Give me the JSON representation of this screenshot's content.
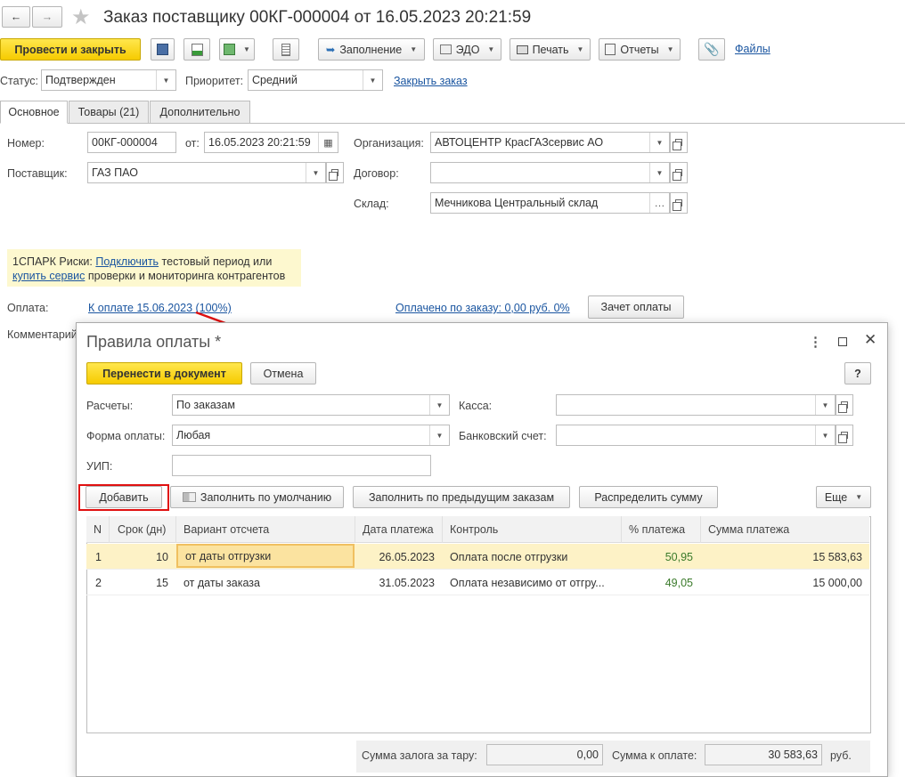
{
  "window": {
    "title": "Заказ поставщику 00КГ-000004 от 16.05.2023 20:21:59"
  },
  "toolbar": {
    "post_close": "Провести и закрыть",
    "fill": "Заполнение",
    "edo": "ЭДО",
    "print": "Печать",
    "reports": "Отчеты",
    "files": "Файлы"
  },
  "status": {
    "label": "Статус:",
    "value": "Подтвержден",
    "priority_label": "Приоритет:",
    "priority_value": "Средний",
    "close_link": "Закрыть заказ"
  },
  "tabs": [
    {
      "label": "Основное"
    },
    {
      "label": "Товары (21)"
    },
    {
      "label": "Дополнительно"
    }
  ],
  "main": {
    "number_label": "Номер:",
    "number": "00КГ-000004",
    "from_label": "от:",
    "date": "16.05.2023 20:21:59",
    "org_label": "Организация:",
    "org": "АВТОЦЕНТР КрасГАЗсервис АО",
    "supplier_label": "Поставщик:",
    "supplier": "ГАЗ ПАО",
    "contract_label": "Договор:",
    "contract": "",
    "warehouse_label": "Склад:",
    "warehouse": "Мечникова Центральный склад",
    "spark_prefix": "1СПАРК Риски: ",
    "spark_link1": "Подключить",
    "spark_text1": " тестовый период или",
    "spark_link2": "купить сервис",
    "spark_text2": " проверки и мониторинга контрагентов",
    "payment_label": "Оплата:",
    "payment_link": "К оплате 15.06.2023 (100%)",
    "paid_link": "Оплачено по заказу: 0,00 руб. 0%",
    "offset_button": "Зачет оплаты",
    "comment_label": "Комментарий"
  },
  "dialog": {
    "title": "Правила оплаты *",
    "transfer": "Перенести в документ",
    "cancel": "Отмена",
    "help": "?",
    "settlements_label": "Расчеты:",
    "settlements": "По заказам",
    "cash_label": "Касса:",
    "cash": "",
    "pay_form_label": "Форма оплаты:",
    "pay_form": "Любая",
    "bank_label": "Банковский счет:",
    "bank": "",
    "uip_label": "УИП:",
    "uip": "",
    "add": "Добавить",
    "fill_default": "Заполнить по умолчанию",
    "fill_prev": "Заполнить по предыдущим заказам",
    "distribute": "Распределить сумму",
    "more": "Еще",
    "columns": [
      "N",
      "Срок (дн)",
      "Вариант отсчета",
      "Дата платежа",
      "Контроль",
      "% платежа",
      "Сумма платежа"
    ],
    "rows": [
      {
        "n": "1",
        "term": "10",
        "variant": "от даты отгрузки",
        "date": "26.05.2023",
        "control": "Оплата после отгрузки",
        "pct": "50,95",
        "sum": "15 583,63"
      },
      {
        "n": "2",
        "term": "15",
        "variant": "от даты заказа",
        "date": "31.05.2023",
        "control": "Оплата независимо от отгру...",
        "pct": "49,05",
        "sum": "15 000,00"
      }
    ],
    "deposit_label": "Сумма залога за тару:",
    "deposit": "0,00",
    "total_label": "Сумма к оплате:",
    "total": "30 583,63",
    "currency": "руб."
  },
  "colors": {
    "accent_yellow": "#f6cb00",
    "link": "#1a55a0",
    "highlight_red": "#e01010",
    "selected_row": "#fdf2c6",
    "pct_green": "#3a7a2a"
  }
}
